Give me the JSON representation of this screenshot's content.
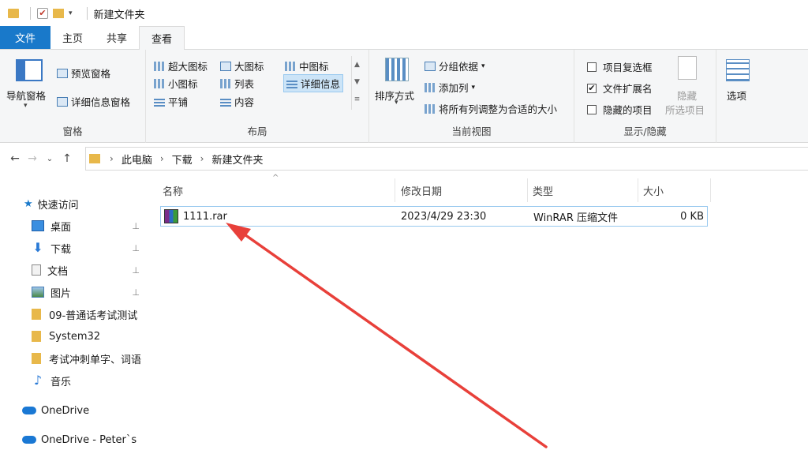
{
  "titlebar": {
    "title": "新建文件夹",
    "dropdown": "▾"
  },
  "tabs": {
    "file": "文件",
    "home": "主页",
    "share": "共享",
    "view": "查看"
  },
  "ribbon": {
    "pane": {
      "nav_pane": "导航窗格",
      "preview_pane": "预览窗格",
      "details_pane": "详细信息窗格",
      "label": "窗格"
    },
    "layout": {
      "extra_large": "超大图标",
      "large": "大图标",
      "medium": "中图标",
      "small": "小图标",
      "list": "列表",
      "details": "详细信息",
      "tiles": "平铺",
      "content": "内容",
      "label": "布局"
    },
    "current_view": {
      "sort_by": "排序方式",
      "group_by": "分组依据",
      "add_column": "添加列",
      "fit_columns": "将所有列调整为合适的大小",
      "label": "当前视图"
    },
    "show_hide": {
      "item_checkboxes": "项目复选框",
      "file_extensions": "文件扩展名",
      "hidden_items": "隐藏的项目",
      "hide": "隐藏",
      "selected_items": "所选项目",
      "label": "显示/隐藏",
      "file_ext_checked": "✔"
    },
    "options": "选项"
  },
  "nav": {
    "back": "←",
    "forward": "→",
    "recent": "⌄",
    "up": "↑"
  },
  "address": {
    "crumbs": [
      "此电脑",
      "下载",
      "新建文件夹"
    ],
    "sep": "›"
  },
  "sidebar": {
    "quick_access": "快速访问",
    "items": [
      "桌面",
      "下载",
      "文档",
      "图片",
      "09-普通话考试测试",
      "System32",
      "考试冲刺单字、词语",
      "音乐"
    ],
    "onedrive": "OneDrive",
    "onedrive_personal": "OneDrive - Peter`s",
    "pin": "📌"
  },
  "columns": {
    "name": "名称",
    "modified": "修改日期",
    "type": "类型",
    "size": "大小",
    "sort_caret": "^"
  },
  "files": [
    {
      "name": "1111.rar",
      "modified": "2023/4/29 23:30",
      "type": "WinRAR 压缩文件",
      "size": "0 KB"
    }
  ],
  "colors": {
    "accent": "#1979ca",
    "arrow": "#e8403a",
    "selection": "#99c9ef"
  }
}
